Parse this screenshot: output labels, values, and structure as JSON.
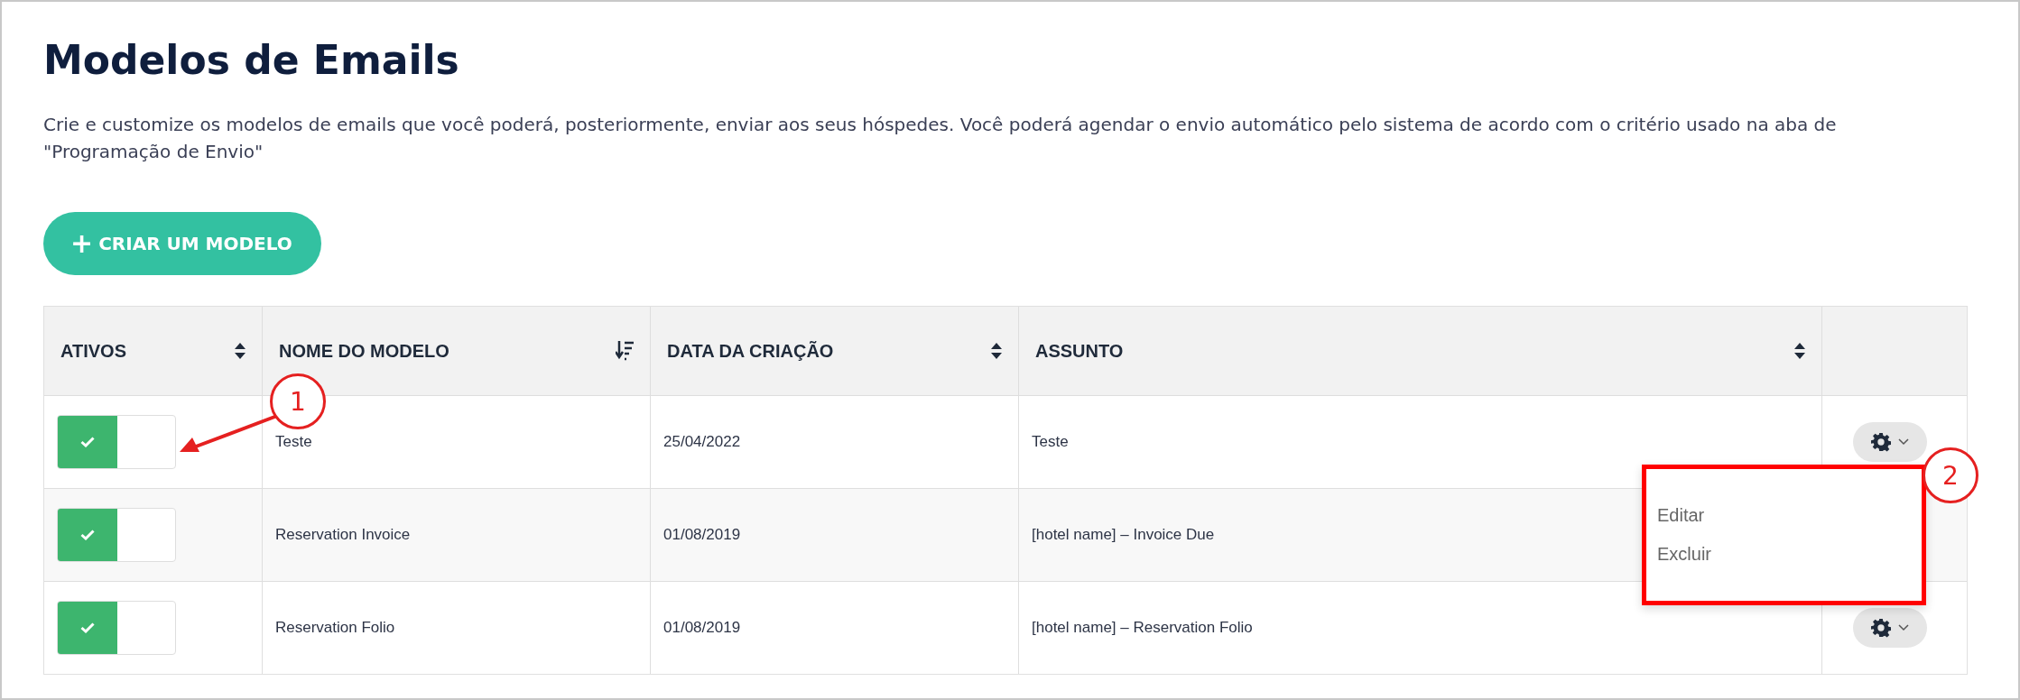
{
  "title": "Modelos de Emails",
  "description": "Crie e customize os modelos de emails que você poderá, posteriormente, enviar aos seus hóspedes. Você poderá agendar o envio automático pelo sistema de acordo com o critério usado na aba de \"Programação de Envio\"",
  "create_button": {
    "icon": "+",
    "label": "CRIAR UM MODELO"
  },
  "table": {
    "columns": [
      {
        "label": "ATIVOS",
        "sorted": false
      },
      {
        "label": "NOME DO MODELO",
        "sorted": true
      },
      {
        "label": "DATA DA CRIAÇÃO",
        "sorted": false
      },
      {
        "label": "ASSUNTO",
        "sorted": false
      }
    ],
    "rows": [
      {
        "on": true,
        "name": "Teste",
        "date": "25/04/2022",
        "subject": "Teste"
      },
      {
        "on": true,
        "name": "Reservation Invoice",
        "date": "01/08/2019",
        "subject": "[hotel name] – Invoice Due"
      },
      {
        "on": true,
        "name": "Reservation Folio",
        "date": "01/08/2019",
        "subject": "[hotel name] – Reservation Folio"
      }
    ]
  },
  "actions_menu": {
    "items": [
      "Editar",
      "Excluir"
    ]
  },
  "callouts": [
    {
      "label": "1"
    },
    {
      "label": "2"
    }
  ]
}
